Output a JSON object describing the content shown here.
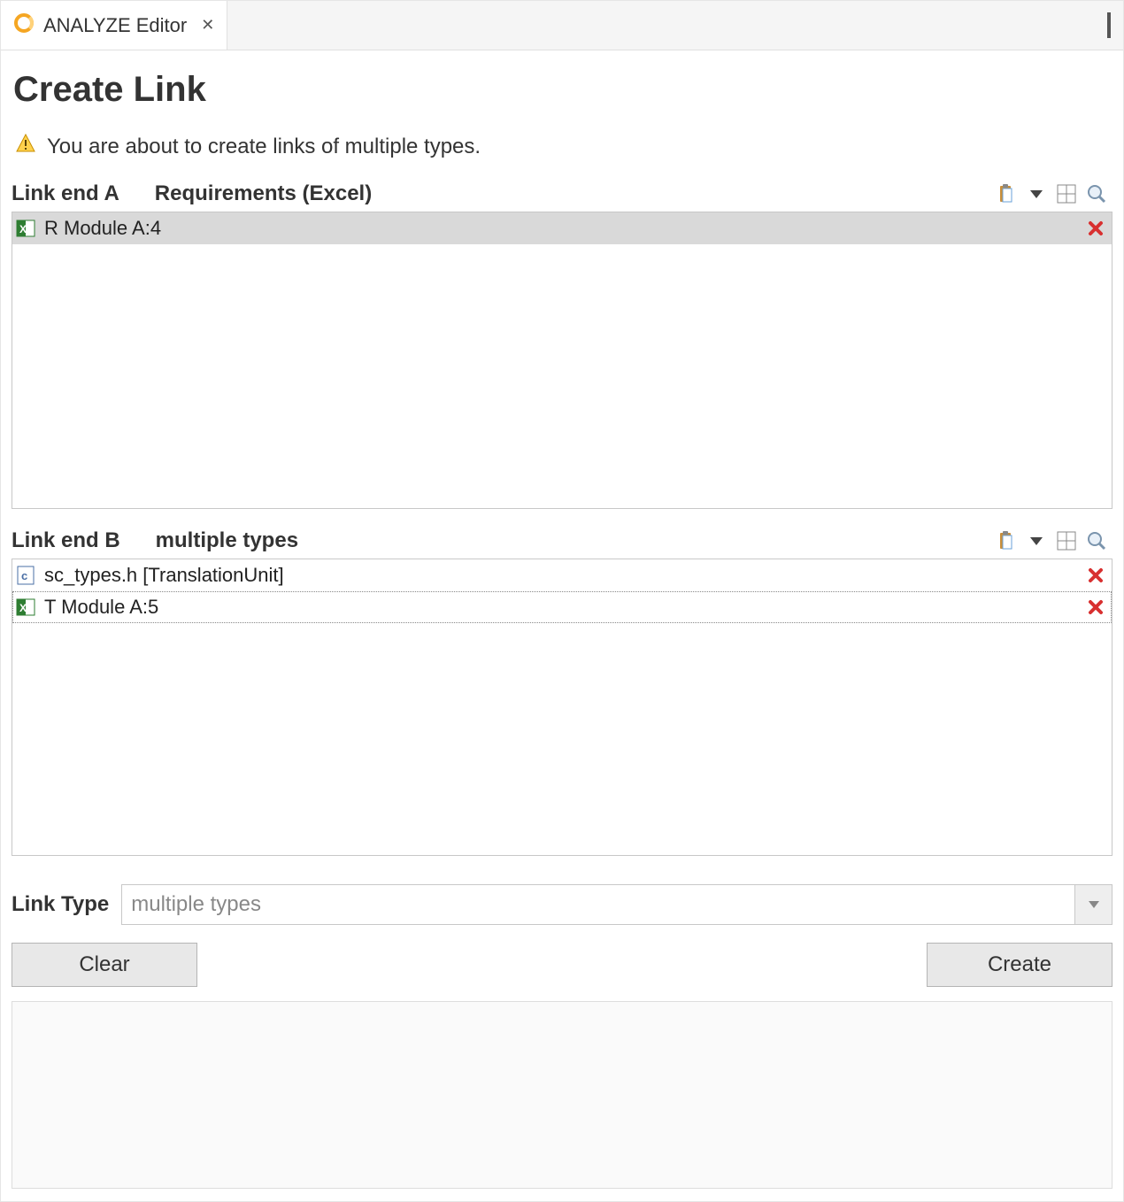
{
  "tab": {
    "title": "ANALYZE Editor"
  },
  "page_title": "Create Link",
  "warning_text": "You are about to create links of multiple types.",
  "section_a": {
    "end_label": "Link end A",
    "type_label": "Requirements (Excel)",
    "items": [
      {
        "icon": "excel-icon",
        "label": "R Module A:4",
        "selected": true
      }
    ]
  },
  "section_b": {
    "end_label": "Link end B",
    "type_label": "multiple types",
    "items": [
      {
        "icon": "c-file-icon",
        "label": "sc_types.h [TranslationUnit]",
        "selected": false
      },
      {
        "icon": "excel-icon",
        "label": "T Module A:5",
        "selected": false,
        "focused": true
      }
    ]
  },
  "link_type": {
    "label": "Link Type",
    "value": "multiple types"
  },
  "buttons": {
    "clear": "Clear",
    "create": "Create"
  }
}
